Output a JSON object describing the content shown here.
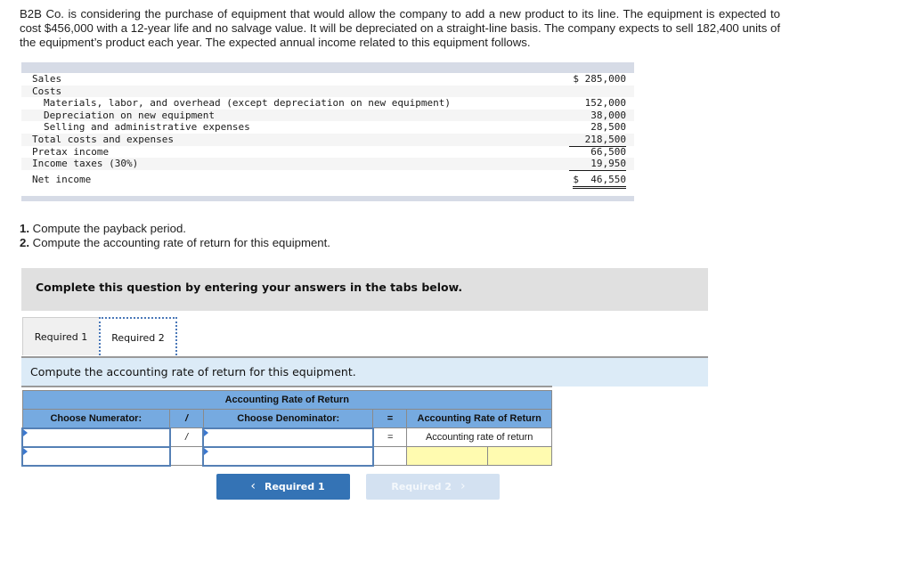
{
  "intro": "B2B Co. is considering the purchase of equipment that would allow the company to add a new product to its line. The equipment is expected to cost $456,000 with a 12-year life and no salvage value. It will be depreciated on a straight-line basis. The company expects to sell 182,400 units of the equipment’s product each year. The expected annual income related to this equipment follows.",
  "statement": {
    "rows": [
      {
        "label": "Sales",
        "value": "$ 285,000"
      },
      {
        "label": "Costs",
        "value": ""
      },
      {
        "label": "Materials, labor, and overhead (except depreciation on new equipment)",
        "value": "152,000"
      },
      {
        "label": "Depreciation on new equipment",
        "value": "38,000"
      },
      {
        "label": "Selling and administrative expenses",
        "value": "28,500"
      },
      {
        "label": "Total costs and expenses",
        "value": "218,500"
      },
      {
        "label": "Pretax income",
        "value": "66,500"
      },
      {
        "label": "Income taxes (30%)",
        "value": "19,950"
      },
      {
        "label": "Net income",
        "value": "$  46,550"
      }
    ]
  },
  "questions": [
    {
      "num": "1.",
      "text": " Compute the payback period."
    },
    {
      "num": "2.",
      "text": " Compute the accounting rate of return for this equipment."
    }
  ],
  "banner": "Complete this question by entering your answers in the tabs below.",
  "tabs": [
    {
      "label": "Required 1",
      "active": false
    },
    {
      "label": "Required 2",
      "active": true
    }
  ],
  "instruction": "Compute the accounting rate of return for this equipment.",
  "arr_table": {
    "title": "Accounting Rate of Return",
    "col_numerator": "Choose Numerator:",
    "col_div": "/",
    "col_denominator": "Choose Denominator:",
    "col_eq": "=",
    "col_result": "Accounting Rate of Return",
    "row1": {
      "numerator": "",
      "div": "/",
      "denominator": "",
      "eq": "=",
      "result": "Accounting rate of return"
    },
    "row2": {
      "numerator": "",
      "div": "",
      "denominator": "",
      "eq": "",
      "result_a": "",
      "result_b": ""
    }
  },
  "nav": {
    "prev_label": "Required 1",
    "next_label": "Required 2",
    "prev_icon": "chevron-left-icon",
    "next_icon": "chevron-right-icon"
  }
}
